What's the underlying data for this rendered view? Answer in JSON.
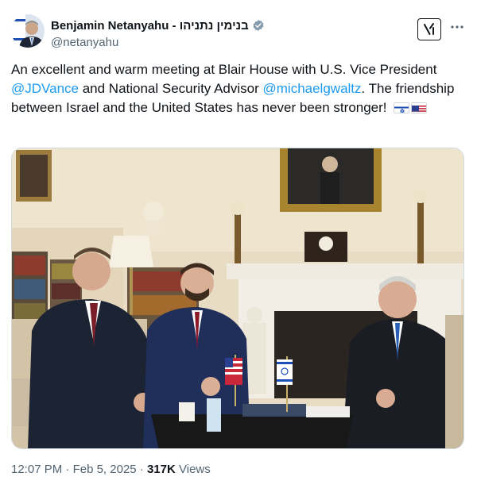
{
  "author": {
    "display_name": "Benjamin Netanyahu - בנימין נתניהו",
    "handle": "@netanyahu",
    "verified_color": "#829aab"
  },
  "header_actions": {
    "grok_icon": "grok-x-icon",
    "more_icon": "more-dots-icon"
  },
  "tweet": {
    "text_part1": "An excellent and warm meeting at Blair House with U.S. Vice President ",
    "mention1": "@JDVance",
    "text_part2": " and National Security Advisor ",
    "mention2": "@michaelgwaltz",
    "text_part3": ". The friendship between Israel and the United States has never been stronger!",
    "flags": [
      "israel-flag-icon",
      "us-flag-icon"
    ]
  },
  "media": {
    "kind": "photo",
    "icon": "photo"
  },
  "footer": {
    "time": "12:07 PM",
    "separator": "·",
    "date": "Feb 5, 2025",
    "views_count": "317K",
    "views_label": "Views"
  },
  "colors": {
    "link": "#1d9bf0",
    "secondary_text": "#536471",
    "primary_text": "#0f1419"
  }
}
